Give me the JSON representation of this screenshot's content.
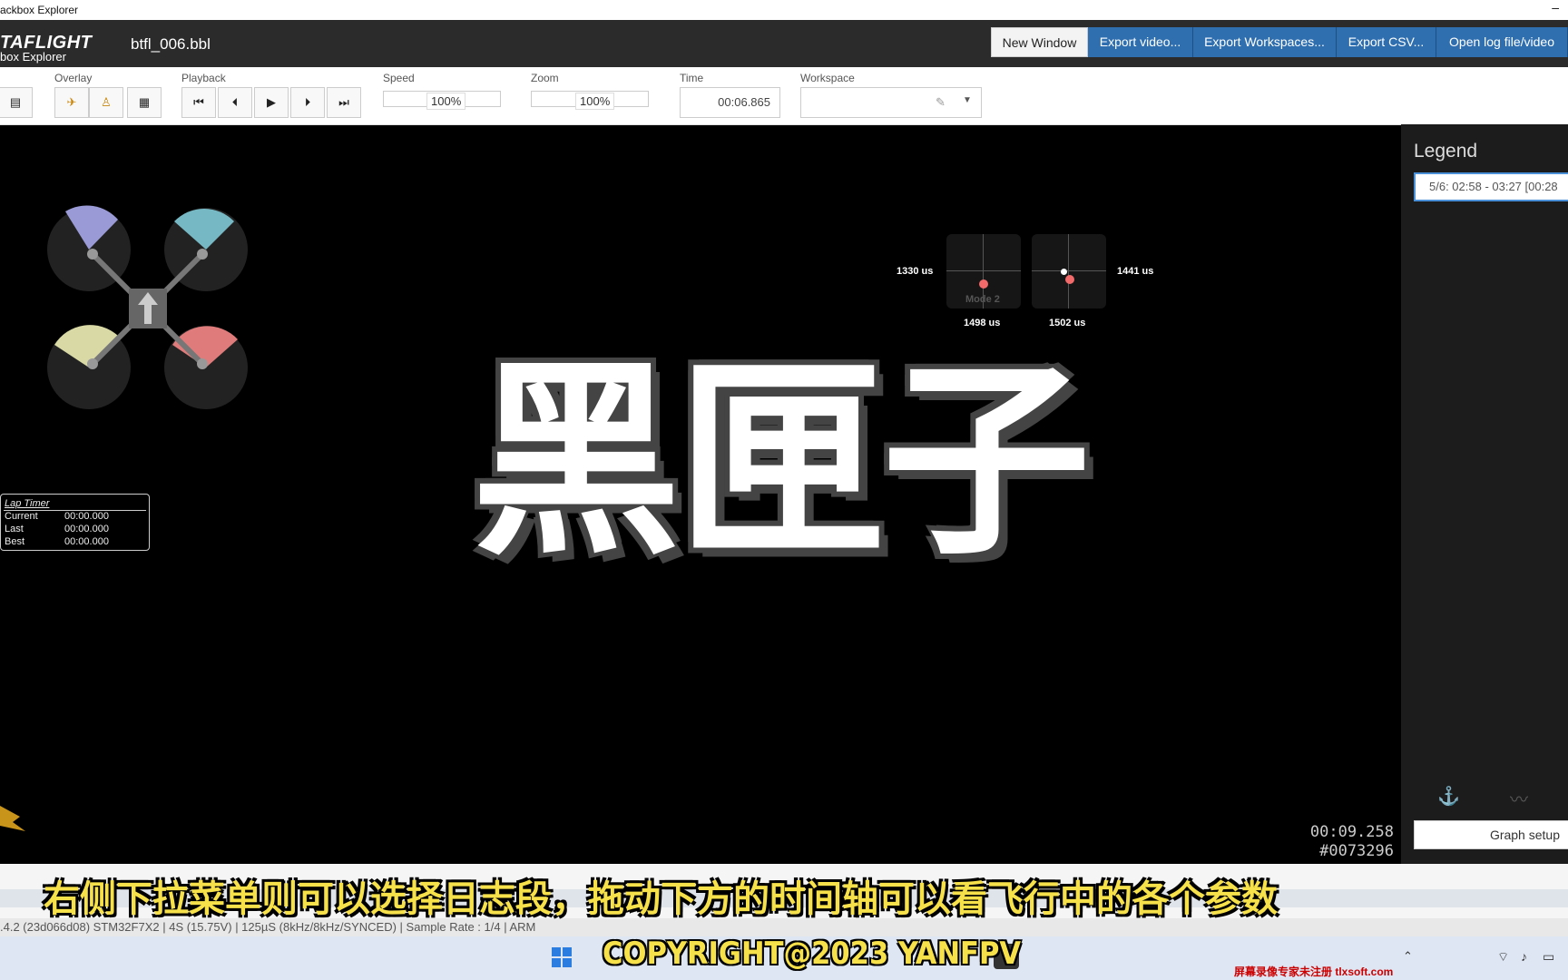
{
  "window": {
    "title": "ackbox Explorer",
    "minimize": "–"
  },
  "header": {
    "logo_top": "TAFLIGHT",
    "logo_bottom": "box Explorer",
    "filename": "btfl_006.bbl",
    "buttons": [
      "New Window",
      "Export video...",
      "Export Workspaces...",
      "Export CSV...",
      "Open log file/video"
    ]
  },
  "toolbar": {
    "overlay_label": "Overlay",
    "playback_label": "Playback",
    "speed_label": "Speed",
    "speed_value": "100%",
    "zoom_label": "Zoom",
    "zoom_value": "100%",
    "time_label": "Time",
    "time_value": "00:06.865",
    "workspace_label": "Workspace"
  },
  "sticks": {
    "left_x_label": "1330 us",
    "left_y_label": "1498 us",
    "mode_label": "Mode 2",
    "right_x_label": "1441 us",
    "right_y_label": "1502 us"
  },
  "lap_timer": {
    "title": "Lap Timer",
    "rows": [
      {
        "label": "Current",
        "value": "00:00.000"
      },
      {
        "label": "Last",
        "value": "00:00.000"
      },
      {
        "label": "Best",
        "value": "00:00.000"
      }
    ]
  },
  "overlay_title": "黑匣子",
  "readout": {
    "time": "00:09.258",
    "frame": "#0073296"
  },
  "legend": {
    "title": "Legend",
    "selected_log": "5/6: 02:58 - 03:27 [00:28",
    "graph_setup": "Graph setup"
  },
  "statusbar": ".4.2 (23d066d08) STM32F7X2 | 4S (15.75V) | 125µS (8kHz/8kHz/SYNCED) | Sample Rate : 1/4 | ARM",
  "subtitle": "右侧下拉菜单则可以选择日志段，拖动下方的时间轴可以看飞行中的各个参数",
  "copyright": "COPYRIGHT@2023 YANFPV",
  "watermark": "屏幕录像专家未注册 tlxsoft.com"
}
